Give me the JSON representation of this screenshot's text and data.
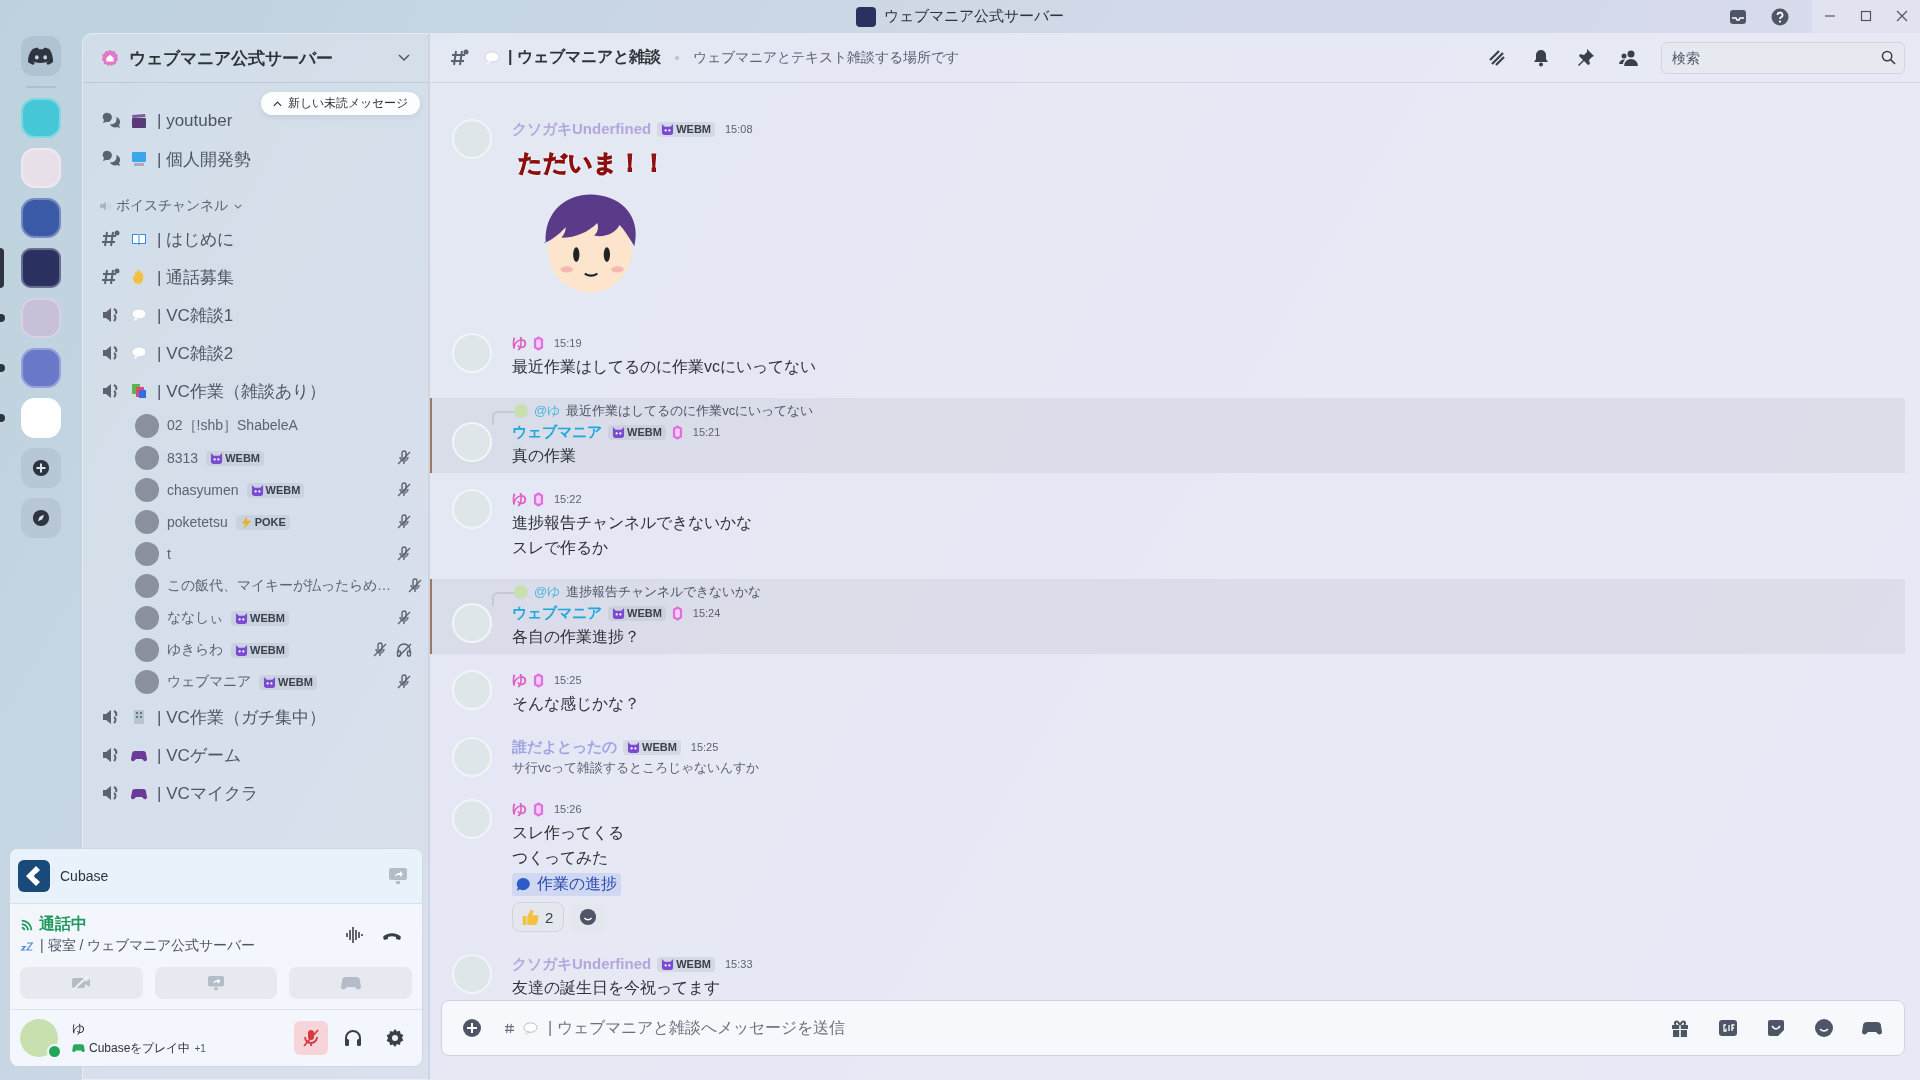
{
  "window": {
    "title": "ウェブマニア公式サーバー"
  },
  "servers": [
    {
      "selected": false,
      "unread": false
    },
    {
      "selected": false,
      "unread": false
    },
    {
      "selected": false,
      "unread": false
    },
    {
      "selected": true,
      "unread": false
    },
    {
      "selected": false,
      "unread": true
    },
    {
      "selected": false,
      "unread": true
    },
    {
      "selected": false,
      "unread": true
    }
  ],
  "sidebar": {
    "server_name": "ウェブマニア公式サーバー",
    "unread_pill": "新しい未読メッセージ",
    "channels": [
      {
        "kind": "forum",
        "name": "| youtuber"
      },
      {
        "kind": "forum",
        "name": "| 個人開発勢"
      },
      {
        "kind": "category",
        "name": "ボイスチャンネル"
      },
      {
        "kind": "text",
        "name": "| はじめに"
      },
      {
        "kind": "text",
        "name": "| 通話募集"
      },
      {
        "kind": "voice",
        "name": "| VC雑談1"
      },
      {
        "kind": "voice",
        "name": "| VC雑談2"
      },
      {
        "kind": "voice",
        "name": "| VC作業（雑談あり）",
        "users": [
          {
            "name": "02［!shb］ShabeleA",
            "muted": false,
            "deafened": false
          },
          {
            "name": "8313",
            "badge": {
              "kind": "cat",
              "text": "WEBM"
            },
            "muted": true,
            "deafened": false
          },
          {
            "name": "chasyumen",
            "badge": {
              "kind": "cat",
              "text": "WEBM"
            },
            "muted": true,
            "deafened": false
          },
          {
            "name": "poketetsu",
            "badge": {
              "kind": "bolt",
              "text": "POKE"
            },
            "muted": true,
            "deafened": false
          },
          {
            "name": "t",
            "muted": true,
            "deafened": false
          },
          {
            "name": "この飯代、マイキーが払ったらめ…",
            "muted": true,
            "deafened": false
          },
          {
            "name": "ななしぃ",
            "badge": {
              "kind": "cat",
              "text": "WEBM"
            },
            "muted": true,
            "deafened": false
          },
          {
            "name": "ゆきらわ",
            "badge": {
              "kind": "cat",
              "text": "WEBM"
            },
            "muted": true,
            "deafened": true
          },
          {
            "name": "ウェブマニア",
            "badge": {
              "kind": "cat",
              "text": "WEBM"
            },
            "muted": true,
            "deafened": false
          }
        ]
      },
      {
        "kind": "voice",
        "name": "| VC作業（ガチ集中）"
      },
      {
        "kind": "voice",
        "name": "| VCゲーム"
      },
      {
        "kind": "voice",
        "name": "| VCマイクラ"
      }
    ]
  },
  "activity": {
    "app": "Cubase"
  },
  "voice": {
    "status": "通話中",
    "location": "| 寝室 / ウェブマニア公式サーバー"
  },
  "user": {
    "name": "ゆ",
    "activity": "Cubaseをプレイ中",
    "extra": "+1",
    "mic_muted": true
  },
  "channel_header": {
    "name": "| ウェブマニアと雑談",
    "topic": "ウェブマニアとテキスト雑談する場所です",
    "search": {
      "placeholder": "検索"
    }
  },
  "messages": [
    {
      "author": "クソガキUnderfined",
      "color": "#b3a6dc",
      "badge": {
        "kind": "cat",
        "text": "WEBM"
      },
      "booster": false,
      "time": "15:08",
      "mentioned": false,
      "kind": "sticker",
      "sticker": {
        "caption": "ただいま！！"
      }
    },
    {
      "author": "ゆ",
      "color": "#e05cc0",
      "booster": true,
      "time": "15:19",
      "mentioned": false,
      "kind": "text",
      "lines": [
        "最近作業はしてるのに作業vcにいってない"
      ]
    },
    {
      "reply": {
        "author": "@ゆ",
        "text": "最近作業はしてるのに作業vcにいってない"
      },
      "author": "ウェブマニア",
      "color": "#1fa8dc",
      "badge": {
        "kind": "cat",
        "text": "WEBM"
      },
      "booster": true,
      "time": "15:21",
      "mentioned": true,
      "kind": "text",
      "lines": [
        "真の作業"
      ]
    },
    {
      "author": "ゆ",
      "color": "#e05cc0",
      "booster": true,
      "time": "15:22",
      "mentioned": false,
      "kind": "text",
      "lines": [
        "進捗報告チャンネルできないかな",
        "スレで作るか"
      ]
    },
    {
      "reply": {
        "author": "@ゆ",
        "text": "進捗報告チャンネルできないかな"
      },
      "author": "ウェブマニア",
      "color": "#1fa8dc",
      "badge": {
        "kind": "cat",
        "text": "WEBM"
      },
      "booster": true,
      "time": "15:24",
      "mentioned": true,
      "kind": "text",
      "lines": [
        "各自の作業進捗？"
      ]
    },
    {
      "author": "ゆ",
      "color": "#e05cc0",
      "booster": true,
      "time": "15:25",
      "mentioned": false,
      "kind": "text",
      "lines": [
        "そんな感じかな？"
      ]
    },
    {
      "author": "誰だよとったの",
      "color": "#9fa6e0",
      "badge": {
        "kind": "cat",
        "text": "WEBM"
      },
      "booster": false,
      "time": "15:25",
      "mentioned": false,
      "kind": "subtext",
      "lines": [
        "サ行vcって雑談するところじゃないんすか"
      ]
    },
    {
      "author": "ゆ",
      "color": "#e05cc0",
      "booster": true,
      "time": "15:26",
      "mentioned": false,
      "kind": "text",
      "lines": [
        "スレ作ってくる",
        "つくってみた"
      ],
      "thread": "作業の進捗",
      "reactions": [
        {
          "count": "2"
        }
      ]
    },
    {
      "author": "クソガキUnderfined",
      "color": "#b3a6dc",
      "badge": {
        "kind": "cat",
        "text": "WEBM"
      },
      "booster": false,
      "time": "15:33",
      "mentioned": false,
      "kind": "text",
      "lines": [
        "友達の誕生日を今祝ってます"
      ]
    }
  ],
  "composer": {
    "placeholder": "| ウェブマニアと雑談へメッセージを送信"
  }
}
